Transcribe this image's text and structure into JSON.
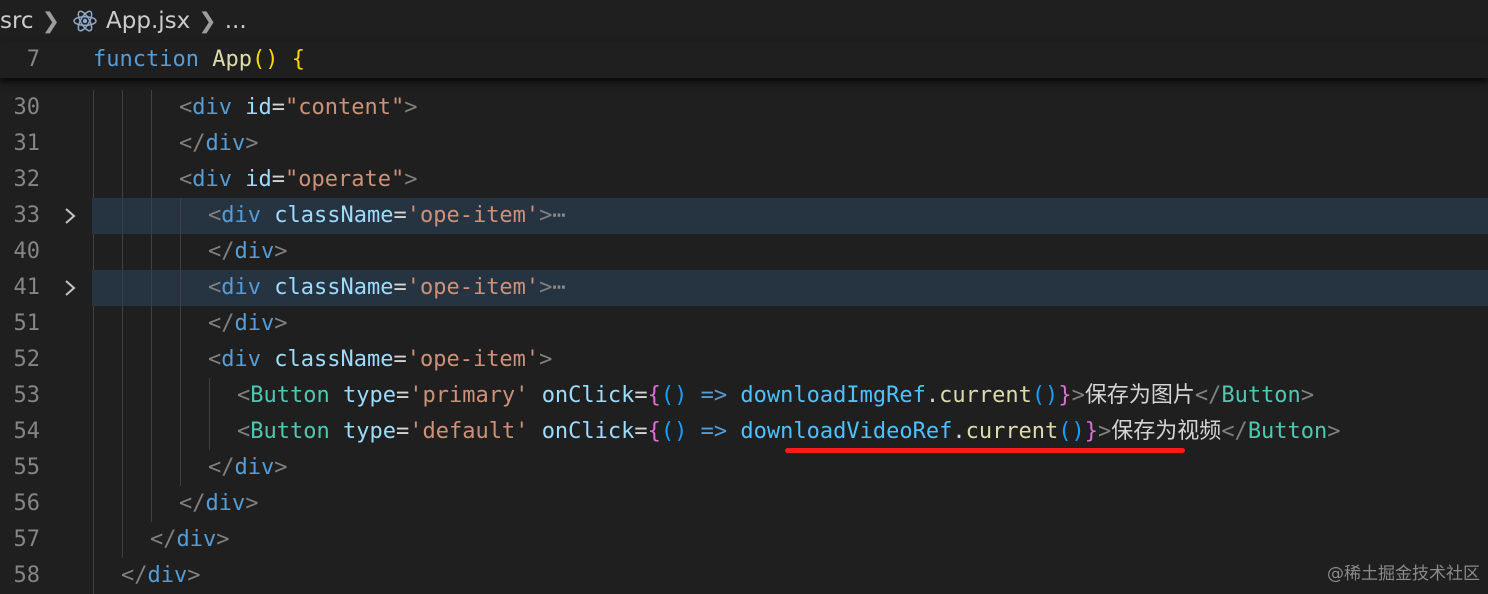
{
  "breadcrumb": {
    "folder": "src",
    "file": "App.jsx",
    "more": "..."
  },
  "sticky": {
    "line_number": "7",
    "keyword": "function",
    "name": "App",
    "parens": "()",
    "brace": "{"
  },
  "lines": [
    {
      "num": "30"
    },
    {
      "num": "31"
    },
    {
      "num": "32"
    },
    {
      "num": "33"
    },
    {
      "num": "40"
    },
    {
      "num": "41"
    },
    {
      "num": "51"
    },
    {
      "num": "52"
    },
    {
      "num": "53"
    },
    {
      "num": "54"
    },
    {
      "num": "55"
    },
    {
      "num": "56"
    },
    {
      "num": "57"
    },
    {
      "num": "58"
    }
  ],
  "code": {
    "lt": "<",
    "lt_slash": "</",
    "gt": ">",
    "div": "div",
    "id_attr": "id",
    "eq": "=",
    "content_str": "\"content\"",
    "operate_str": "\"operate\"",
    "classname_attr": "className",
    "ope_item_str": "'ope-item'",
    "folded_ellipsis": "⋯",
    "button": "Button",
    "type_attr": "type",
    "primary_str": "'primary'",
    "default_str": "'default'",
    "onclick_attr": "onClick",
    "open_brace": "{",
    "close_brace": "}",
    "arrow_params": "()",
    "arrow": "=>",
    "img_ref": "downloadImgRef",
    "video_ref": "downloadVideoRef",
    "dot": ".",
    "current": "current",
    "call": "()",
    "save_image_label": "保存为图片",
    "save_video_label": "保存为视频"
  },
  "watermark": "@稀土掘金技术社区",
  "colors": {
    "background": "#1f1f1f",
    "highlight": "#263340",
    "annotation_underline": "#ff1a1a"
  }
}
